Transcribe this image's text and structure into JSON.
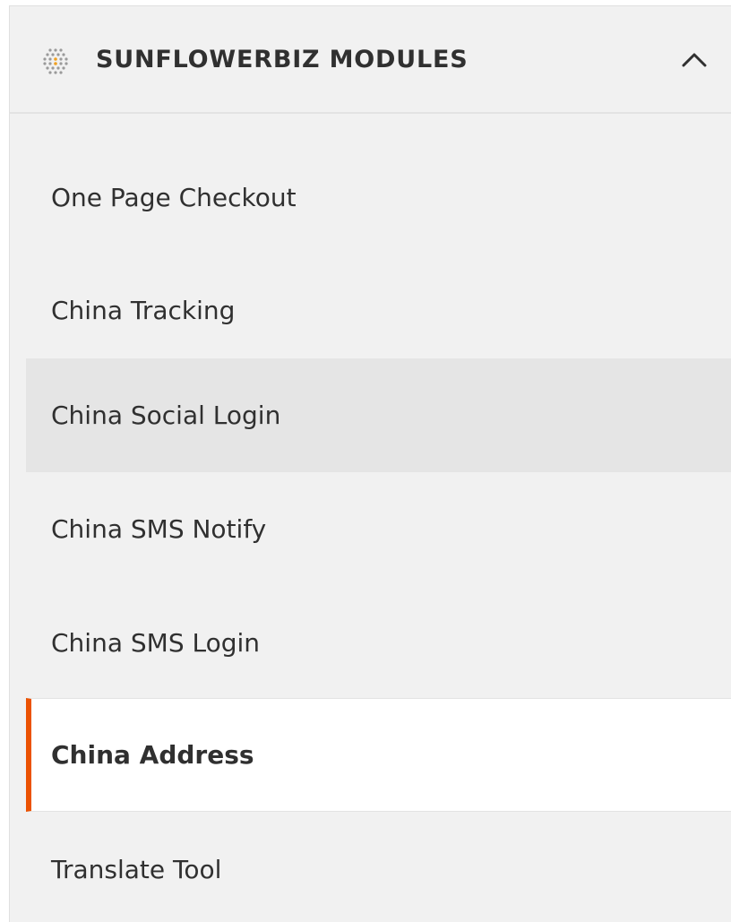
{
  "section": {
    "title": "SUNFLOWERBIZ MODULES",
    "icon": "sunflower-logo-icon",
    "toggle_icon": "chevron-up-icon",
    "expanded": true
  },
  "menu": {
    "items": [
      {
        "label": "One Page Checkout",
        "state": "default"
      },
      {
        "label": "China Tracking",
        "state": "default"
      },
      {
        "label": "China Social Login",
        "state": "hover"
      },
      {
        "label": "China SMS Notify",
        "state": "default"
      },
      {
        "label": "China SMS Login",
        "state": "default"
      },
      {
        "label": "China Address",
        "state": "active"
      },
      {
        "label": "Translate Tool",
        "state": "default"
      }
    ]
  },
  "colors": {
    "panel_background": "#f1f1f1",
    "hover_background": "#e5e5e5",
    "active_background": "#ffffff",
    "active_accent": "#eb5202",
    "text": "#303030"
  }
}
